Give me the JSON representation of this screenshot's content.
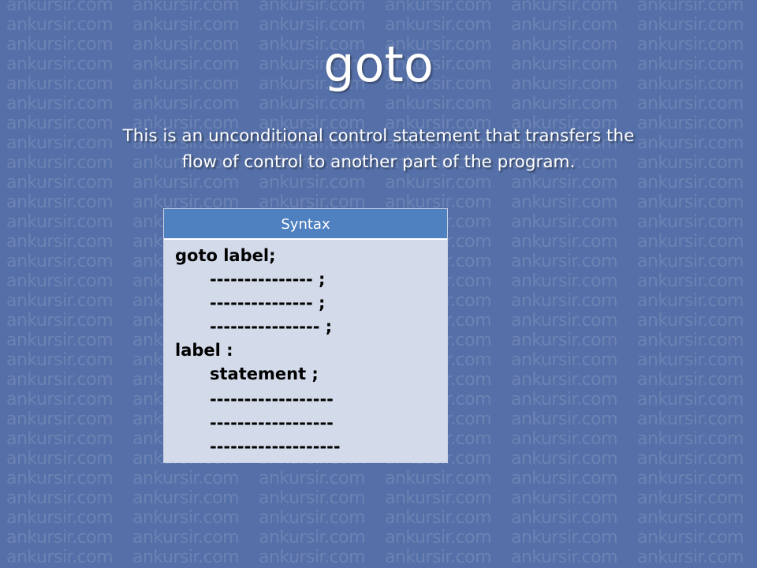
{
  "watermark": {
    "text": "ankursir.com"
  },
  "slide": {
    "title": "goto",
    "description_line1": "This is an unconditional control statement that transfers the",
    "description_line2": "flow of control to another part of the program."
  },
  "syntax_box": {
    "header": "Syntax",
    "lines": [
      "goto label;",
      "--------------- ;",
      "--------------- ;",
      "---------------- ;",
      "label :",
      "statement ;",
      "------------------",
      "------------------",
      "-------------------"
    ]
  },
  "colors": {
    "background": "#5570a8",
    "header_bar": "#4f80c0",
    "box_body": "#d3dbea"
  }
}
